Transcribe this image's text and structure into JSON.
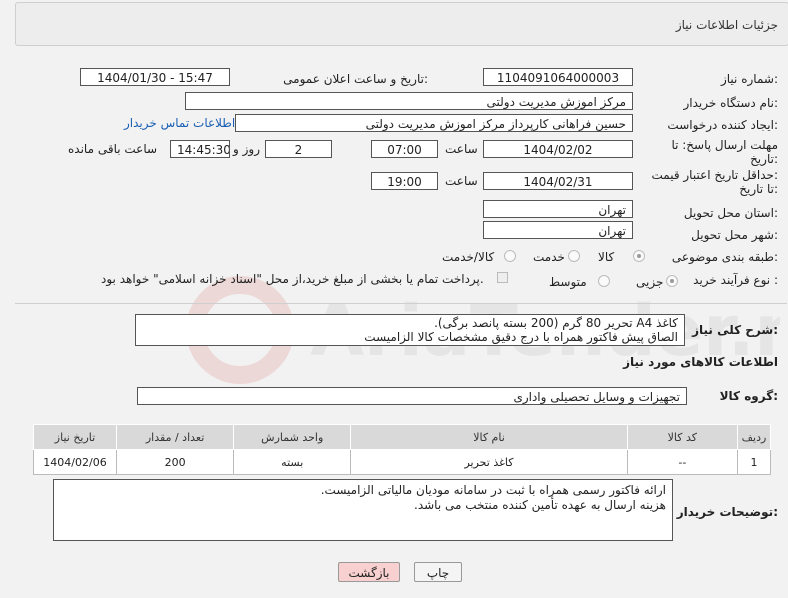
{
  "panel": {
    "title": "جزئیات اطلاعات نیاز"
  },
  "form": {
    "need_number": {
      "label": "شماره نیاز:",
      "value": "1104091064000003"
    },
    "announce": {
      "label": "تاریخ و ساعت اعلان عمومی:",
      "value": "1404/01/30 - 15:47"
    },
    "buyer_org": {
      "label": "نام دستگاه خریدار:",
      "value": "مرکز اموزش مدیریت دولتی"
    },
    "requester": {
      "label": "ایجاد کننده درخواست:",
      "value": "حسین  فراهانی کارپرداز مرکز اموزش مدیریت دولتی",
      "contact_link": "اطلاعات تماس خریدار"
    },
    "deadline": {
      "label1": "مهلت ارسال پاسخ: تا",
      "label2": "تاریخ:",
      "date": "1404/02/02",
      "time_label": "ساعت",
      "time": "07:00",
      "days": "2",
      "days_label": "روز و",
      "remaining": "14:45:30",
      "remaining_label": "ساعت باقی مانده"
    },
    "validity": {
      "label1": "حداقل تاریخ اعتبار قیمت:",
      "label2": "تا تاریخ:",
      "date": "1404/02/31",
      "time_label": "ساعت",
      "time": "19:00"
    },
    "province": {
      "label": "استان محل تحویل:",
      "value": "تهران"
    },
    "city": {
      "label": "شهر محل تحویل:",
      "value": "تهران"
    },
    "category": {
      "label": "طبقه بندی موضوعی:",
      "options": [
        "کالا",
        "خدمت",
        "کالا/خدمت"
      ],
      "selected": "کالا"
    },
    "process": {
      "label": "نوع فرآیند خرید :",
      "options": [
        "جزیی",
        "متوسط"
      ],
      "selected": "جزیی",
      "note": "پرداخت تمام یا بخشی از مبلغ خرید،از محل \"اسناد خزانه اسلامی\" خواهد بود."
    },
    "description": {
      "label": "شرح کلی نیاز:",
      "line1": "کاغذ A4 تحریر 80 گرم (200 بسته پانصد برگی).",
      "line2": "الصاق پیش فاکتور همراه با درج دقیق مشخصات کالا الزامیست"
    }
  },
  "goods": {
    "section_title": "اطلاعات کالاهای مورد نیاز",
    "group_label": "گروه کالا:",
    "group_value": "تجهیزات و وسایل تحصیلی واداری",
    "columns": [
      "ردیف",
      "کد کالا",
      "نام کالا",
      "واحد شمارش",
      "تعداد / مقدار",
      "تاریخ نیاز"
    ],
    "rows": [
      [
        "1",
        "--",
        "کاغذ تحریر",
        "بسته",
        "200",
        "1404/02/06"
      ]
    ]
  },
  "buyer_notes": {
    "label": "توضیحات خریدار:",
    "line1": "ارائه فاکتور رسمی همراه با ثبت در سامانه مودیان مالیاتی الزامیست.",
    "line2": "هزینه ارسال به عهده تأمین کننده منتخب می باشد."
  },
  "buttons": {
    "print": "چاپ",
    "back": "بازگشت"
  },
  "watermark": {
    "text": "AriaTender.neT"
  }
}
